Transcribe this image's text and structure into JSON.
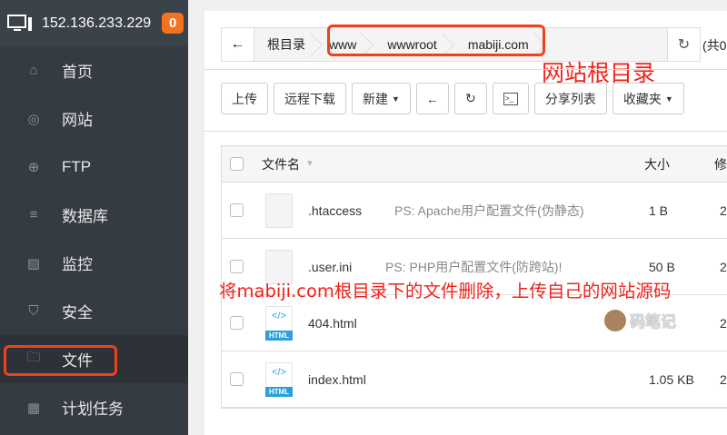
{
  "sidebar": {
    "server_ip": "152.136.233.229",
    "badge_count": "0",
    "items": [
      {
        "label": "首页",
        "icon": "home-icon"
      },
      {
        "label": "网站",
        "icon": "globe-icon"
      },
      {
        "label": "FTP",
        "icon": "ftp-icon"
      },
      {
        "label": "数据库",
        "icon": "database-icon"
      },
      {
        "label": "监控",
        "icon": "monitor-icon"
      },
      {
        "label": "安全",
        "icon": "shield-icon"
      },
      {
        "label": "文件",
        "icon": "folder-icon",
        "active": true
      },
      {
        "label": "计划任务",
        "icon": "calendar-icon"
      }
    ]
  },
  "breadcrumb": {
    "items": [
      "根目录",
      "www",
      "wwwroot",
      "mabiji.com"
    ],
    "count_text": "(共0"
  },
  "toolbar": {
    "upload": "上传",
    "remote_download": "远程下载",
    "new": "新建",
    "share_list": "分享列表",
    "favorites": "收藏夹"
  },
  "table": {
    "headers": {
      "name": "文件名",
      "size": "大小",
      "modified": "修"
    },
    "rows": [
      {
        "name": ".htaccess",
        "note": "PS: Apache用户配置文件(伪静态)",
        "size": "1 B",
        "modified": "2",
        "type": "file"
      },
      {
        "name": ".user.ini",
        "note": "PS: PHP用户配置文件(防跨站)!",
        "size": "50 B",
        "modified": "2",
        "type": "file"
      },
      {
        "name": "404.html",
        "note": "",
        "size": "",
        "modified": "2",
        "type": "html"
      },
      {
        "name": "index.html",
        "note": "",
        "size": "1.05 KB",
        "modified": "2",
        "type": "html"
      }
    ]
  },
  "annotations": {
    "root_dir": "网站根目录",
    "instruction": "将mabiji.com根目录下的文件删除，上传自己的网站源码"
  },
  "watermark": "码笔记",
  "html_tag": "HTML",
  "colors": {
    "accent": "#f5721f",
    "annotation": "#f0211a",
    "sidebar": "#343b43"
  }
}
